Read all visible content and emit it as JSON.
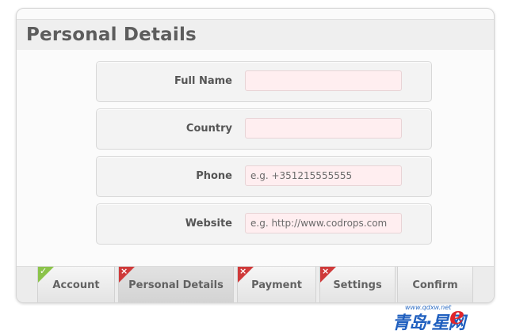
{
  "form": {
    "title": "Personal Details",
    "fields": [
      {
        "label": "Full Name",
        "value": "",
        "placeholder": ""
      },
      {
        "label": "Country",
        "value": "",
        "placeholder": ""
      },
      {
        "label": "Phone",
        "value": "",
        "placeholder": "e.g. +351215555555"
      },
      {
        "label": "Website",
        "value": "",
        "placeholder": "e.g. http://www.codrops.com"
      }
    ]
  },
  "tabs": [
    {
      "label": "Account",
      "status": "valid",
      "status_icon": "check-icon",
      "mark": "✓"
    },
    {
      "label": "Personal Details",
      "status": "error",
      "status_icon": "error-x-icon",
      "mark": "×",
      "active": true
    },
    {
      "label": "Payment",
      "status": "error",
      "status_icon": "error-x-icon",
      "mark": "×"
    },
    {
      "label": "Settings",
      "status": "error",
      "status_icon": "error-x-icon",
      "mark": "×"
    },
    {
      "label": "Confirm",
      "status": "none"
    }
  ],
  "watermark": {
    "url": "www.qdxw.net",
    "text_cn": "青岛·星网",
    "letter": "e"
  },
  "colors": {
    "input_bg": "#ffeef0",
    "error": "#cf3a3a",
    "valid": "#8bc34a",
    "title_text": "#5d5d5d"
  }
}
